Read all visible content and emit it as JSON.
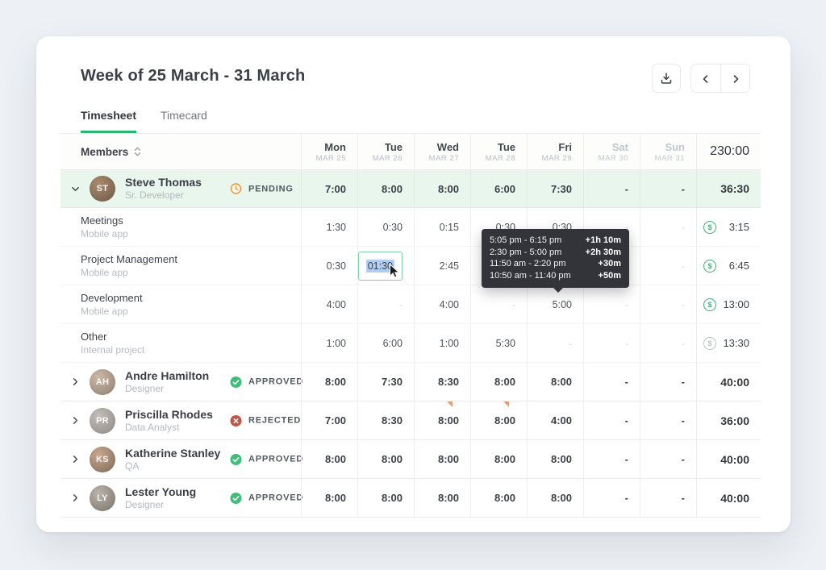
{
  "header": {
    "title": "Week of 25 March - 31 March",
    "tabs": [
      {
        "label": "Timesheet",
        "active": true
      },
      {
        "label": "Timecard",
        "active": false
      }
    ],
    "toolbar_icons": [
      "download-icon",
      "chevron-left-icon",
      "chevron-right-icon"
    ]
  },
  "colors": {
    "accent_green": "#2bb673",
    "mint_row": "#e8f6ee",
    "pending_orange": "#e2973f",
    "approved_green": "#41bd79",
    "rejected_red": "#bf5748",
    "tooltip_bg": "#323439",
    "selection_blue": "#b1cef1",
    "flag_orange": "#d98e63"
  },
  "table": {
    "members_header": "Members",
    "sort_icon": "sort-icon",
    "week_total": "230:00",
    "days": [
      {
        "name": "Mon",
        "date": "MAR 25",
        "muted": false
      },
      {
        "name": "Tue",
        "date": "MAR 26",
        "muted": false
      },
      {
        "name": "Wed",
        "date": "MAR 27",
        "muted": false
      },
      {
        "name": "Tue",
        "date": "MAR 28",
        "muted": false
      },
      {
        "name": "Fri",
        "date": "MAR 29",
        "muted": false
      },
      {
        "name": "Sat",
        "date": "MAR 30",
        "muted": true
      },
      {
        "name": "Sun",
        "date": "MAR 31",
        "muted": true
      }
    ],
    "rows": [
      {
        "type": "member",
        "expanded": true,
        "highlight": true,
        "name": "Steve Thomas",
        "role": "Sr. Developer",
        "status": {
          "label": "PENDING",
          "kind": "pending"
        },
        "values": [
          "7:00",
          "8:00",
          "8:00",
          "6:00",
          "7:30",
          "-",
          "-"
        ],
        "total": "36:30"
      },
      {
        "type": "task",
        "task": "Meetings",
        "project": "Mobile app",
        "billable": true,
        "values": [
          "1:30",
          "0:30",
          "0:15",
          "0:30",
          "0:30",
          "-",
          "-"
        ],
        "total": "3:15"
      },
      {
        "type": "task",
        "task": "Project Management",
        "project": "Mobile app",
        "billable": true,
        "values": [
          "0:30",
          "",
          "2:45",
          "",
          "",
          "",
          "-"
        ],
        "total": "6:45"
      },
      {
        "type": "task",
        "task": "Development",
        "project": "Mobile app",
        "billable": true,
        "values": [
          "4:00",
          "-",
          "4:00",
          "-",
          "5:00",
          "-",
          "-"
        ],
        "total": "13:00"
      },
      {
        "type": "task",
        "task": "Other",
        "project": "Internal project",
        "billable": false,
        "values": [
          "1:00",
          "6:00",
          "1:00",
          "5:30",
          "-",
          "-",
          "-"
        ],
        "total": "13:30"
      },
      {
        "type": "member",
        "expanded": false,
        "name": "Andre Hamilton",
        "role": "Designer",
        "status": {
          "label": "APPROVED",
          "kind": "approved"
        },
        "values": [
          "8:00",
          "7:30",
          "8:30",
          "8:00",
          "8:00",
          "-",
          "-"
        ],
        "total": "40:00"
      },
      {
        "type": "member",
        "expanded": false,
        "name": "Priscilla Rhodes",
        "role": "Data Analyst",
        "status": {
          "label": "REJECTED",
          "kind": "rejected"
        },
        "flags": [
          2,
          3
        ],
        "values": [
          "7:00",
          "8:30",
          "8:00",
          "8:00",
          "4:00",
          "-",
          "-"
        ],
        "total": "36:00"
      },
      {
        "type": "member",
        "expanded": false,
        "name": "Katherine Stanley",
        "role": "QA",
        "status": {
          "label": "APPROVED",
          "kind": "approved"
        },
        "values": [
          "8:00",
          "8:00",
          "8:00",
          "8:00",
          "8:00",
          "-",
          "-"
        ],
        "total": "40:00"
      },
      {
        "type": "member",
        "expanded": false,
        "name": "Lester Young",
        "role": "Designer",
        "status": {
          "label": "APPROVED",
          "kind": "approved"
        },
        "values": [
          "8:00",
          "8:00",
          "8:00",
          "8:00",
          "8:00",
          "-",
          "-"
        ],
        "total": "40:00"
      }
    ]
  },
  "editing_cell": {
    "row_index": 2,
    "col_index": 1,
    "value": "01:30"
  },
  "tooltip": {
    "entries": [
      {
        "range": "5:05 pm - 6:15 pm",
        "duration": "+1h 10m"
      },
      {
        "range": "2:30 pm - 5:00 pm",
        "duration": "+2h 30m"
      },
      {
        "range": "11:50 am - 2:20 pm",
        "duration": "+30m"
      },
      {
        "range": "10:50 am - 11:40 pm",
        "duration": "+50m"
      }
    ]
  }
}
